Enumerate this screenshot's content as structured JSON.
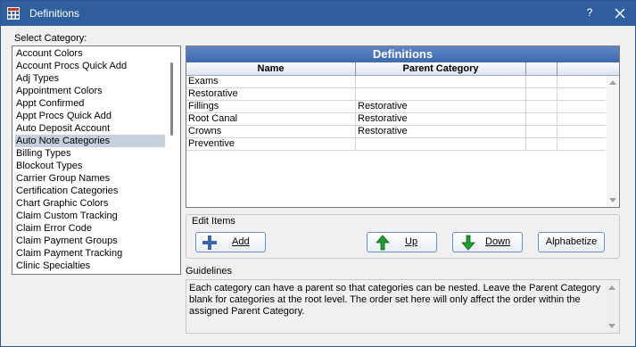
{
  "window": {
    "title": "Definitions",
    "help": "?"
  },
  "select_category_label": "Select Category:",
  "categories": [
    "Account Colors",
    "Account Procs Quick Add",
    "Adj Types",
    "Appointment Colors",
    "Appt Confirmed",
    "Appt Procs Quick Add",
    "Auto Deposit Account",
    "Auto Note Categories",
    "Billing Types",
    "Blockout Types",
    "Carrier Group Names",
    "Certification Categories",
    "Chart Graphic Colors",
    "Claim Custom Tracking",
    "Claim Error Code",
    "Claim Payment Groups",
    "Claim Payment Tracking",
    "Clinic Specialties"
  ],
  "selected_category": "Auto Note Categories",
  "grid": {
    "title": "Definitions",
    "columns": [
      "Name",
      "Parent Category"
    ],
    "rows": [
      [
        "Exams",
        ""
      ],
      [
        "Restorative",
        ""
      ],
      [
        "Fillings",
        "Restorative"
      ],
      [
        "Root Canal",
        "Restorative"
      ],
      [
        "Crowns",
        "Restorative"
      ],
      [
        "Preventive",
        ""
      ]
    ]
  },
  "edit_items": {
    "label": "Edit Items",
    "add": "Add",
    "up": "Up",
    "down": "Down",
    "alphabetize": "Alphabetize"
  },
  "guidelines": {
    "label": "Guidelines",
    "text": "Each category can have a parent so that categories can be nested. Leave the Parent Category blank for categories at the root level. The order set here will only affect the order within the assigned Parent Category."
  },
  "colors": {
    "title_bar": "#2f5f9e",
    "grid_title": "#4a76b8",
    "selected_row": "#c6d0dd",
    "arrow_green": "#1f9e2c",
    "add_icon": "#3d63a8"
  }
}
